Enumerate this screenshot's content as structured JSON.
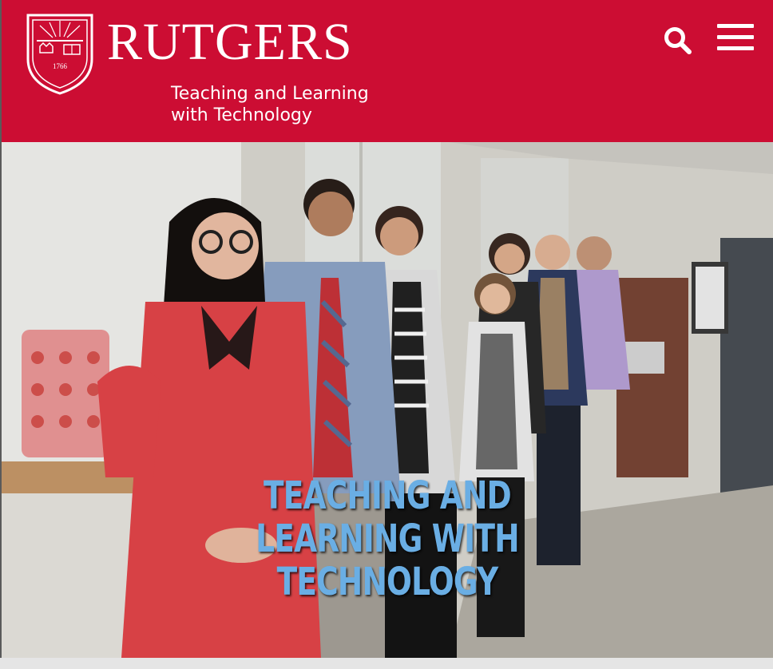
{
  "header": {
    "brand": "RUTGERS",
    "tagline_line1": "Teaching and Learning",
    "tagline_line2": "with Technology",
    "shield_year": "1766",
    "icons": {
      "search": "search-icon",
      "menu": "hamburger-menu-icon"
    },
    "background_color": "#cc0d33"
  },
  "hero": {
    "title": "Teaching and Learning with Technology",
    "title_color": "#6aaee4",
    "image": "group-photo-of-staff"
  }
}
